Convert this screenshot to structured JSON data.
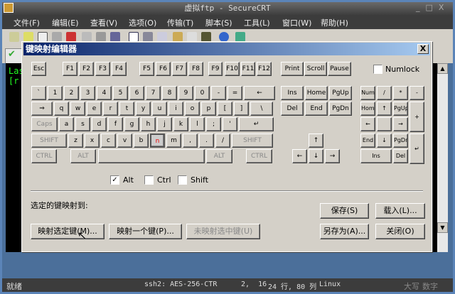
{
  "window": {
    "title": "虚拟ftp - SecureCRT"
  },
  "menu": [
    "文件(F)",
    "编辑(E)",
    "查看(V)",
    "选项(O)",
    "传输(T)",
    "脚本(S)",
    "工具(L)",
    "窗口(W)",
    "帮助(H)"
  ],
  "terminal": {
    "lines": [
      "Las",
      "[r"
    ]
  },
  "dialog": {
    "title": "键映射编辑器",
    "close": "X",
    "function_row": [
      "Esc",
      "F1",
      "F2",
      "F3",
      "F4",
      "F5",
      "F6",
      "F7",
      "F8",
      "F9",
      "F10",
      "F11",
      "F12",
      "Print",
      "Scroll",
      "Pause"
    ],
    "numlock_label": "Numlock",
    "main_rows": [
      [
        "`",
        "1",
        "2",
        "3",
        "4",
        "5",
        "6",
        "7",
        "8",
        "9",
        "0",
        "-",
        "=",
        "←"
      ],
      [
        "⇒",
        "q",
        "w",
        "e",
        "r",
        "t",
        "y",
        "u",
        "i",
        "o",
        "p",
        "[",
        "]",
        "\\"
      ],
      [
        "Caps",
        "a",
        "s",
        "d",
        "f",
        "g",
        "h",
        "j",
        "k",
        "l",
        ";",
        "'",
        "↵"
      ],
      [
        "SHIFT",
        "z",
        "x",
        "c",
        "v",
        "b",
        "n",
        "m",
        ",",
        ".",
        "/",
        "SHIFT"
      ],
      [
        "CTRL",
        "ALT",
        "",
        "ALT",
        "CTRL"
      ]
    ],
    "selected_key": "n",
    "nav_keys": [
      "Ins",
      "Home",
      "PgUp",
      "Del",
      "End",
      "PgDn"
    ],
    "arrow_keys": [
      "↑",
      "←",
      "↓",
      "→"
    ],
    "numpad_keys": [
      "Num",
      "/",
      "*",
      "-",
      "Home",
      "↑",
      "PgUp",
      "+",
      "←",
      "",
      "→",
      "End",
      "↓",
      "PgDn",
      "↵",
      "Ins",
      "Del"
    ],
    "modifiers": [
      {
        "label": "Alt",
        "checked": true
      },
      {
        "label": "Ctrl",
        "checked": false
      },
      {
        "label": "Shift",
        "checked": false
      }
    ],
    "mapped_to_label": "选定的键映射到:",
    "buttons": {
      "save": "保存(S)",
      "load": "载入(L)...",
      "map_selected": "映射选定键(M)...",
      "map_one": "映射一个键(P)...",
      "unmap": "未映射选中键(U)",
      "save_as": "另存为(A)...",
      "close": "关闭(O)"
    }
  },
  "status": {
    "ready": "就绪",
    "cipher": "ssh2: AES-256-CTR",
    "cursor": "2,  16",
    "size": "24 行, 80 列",
    "os": "Linux",
    "caps": "大写",
    "num": "数字"
  }
}
